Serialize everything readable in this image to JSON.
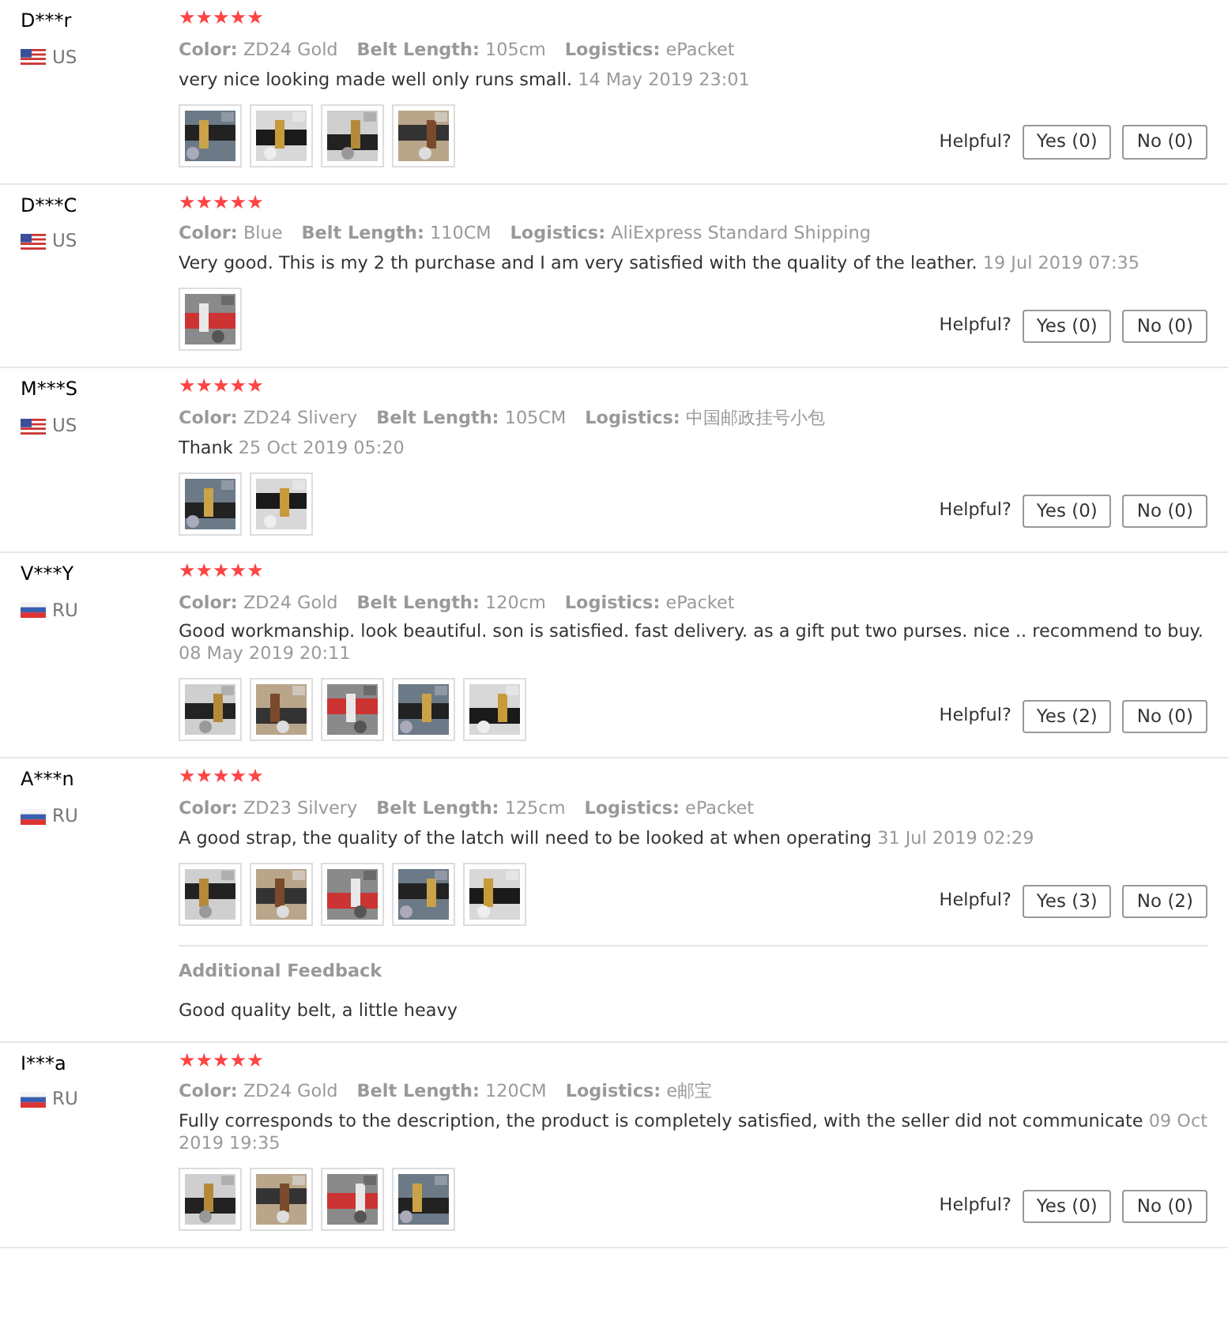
{
  "reviews": [
    {
      "name": "D***r",
      "country": {
        "code": "US",
        "kind": "us"
      },
      "stars": 5,
      "attributes": [
        {
          "label": "Color:",
          "value": "ZD24 Gold"
        },
        {
          "label": "Belt Length:",
          "value": "105cm"
        },
        {
          "label": "Logistics:",
          "value": "ePacket"
        }
      ],
      "text": "very nice looking made well only runs small.",
      "date": "14 May 2019 23:01",
      "photos": [
        {
          "kind": "picture"
        },
        {
          "kind": "picture"
        },
        {
          "kind": "picture"
        },
        {
          "kind": "picture"
        }
      ],
      "helpful_label": "Helpful?",
      "yes": "Yes (0)",
      "no": "No (0)"
    },
    {
      "name": "D***C",
      "country": {
        "code": "US",
        "kind": "us"
      },
      "stars": 5,
      "attributes": [
        {
          "label": "Color:",
          "value": "Blue"
        },
        {
          "label": "Belt Length:",
          "value": "110CM"
        },
        {
          "label": "Logistics:",
          "value": "AliExpress Standard Shipping"
        }
      ],
      "text": "Very good. This is my 2 th purchase and I am very satisfied with the quality of the leather.",
      "date": "19 Jul 2019 07:35",
      "photos": [
        {
          "kind": "picture"
        }
      ],
      "helpful_label": "Helpful?",
      "yes": "Yes (0)",
      "no": "No (0)"
    },
    {
      "name": "M***S",
      "country": {
        "code": "US",
        "kind": "us"
      },
      "stars": 5,
      "attributes": [
        {
          "label": "Color:",
          "value": "ZD24 Slivery"
        },
        {
          "label": "Belt Length:",
          "value": "105CM"
        },
        {
          "label": "Logistics:",
          "value": "中国邮政挂号小包"
        }
      ],
      "text": "Thank",
      "date": "25 Oct 2019 05:20",
      "photos": [
        {
          "kind": "picture"
        },
        {
          "kind": "picture"
        }
      ],
      "helpful_label": "Helpful?",
      "yes": "Yes (0)",
      "no": "No (0)"
    },
    {
      "name": "V***Y",
      "country": {
        "code": "RU",
        "kind": "ru"
      },
      "stars": 5,
      "attributes": [
        {
          "label": "Color:",
          "value": "ZD24 Gold"
        },
        {
          "label": "Belt Length:",
          "value": "120cm"
        },
        {
          "label": "Logistics:",
          "value": "ePacket"
        }
      ],
      "text": "Good workmanship. look beautiful. son is satisfied. fast delivery. as a gift put two purses. nice .. recommend to buy.",
      "date": "08 May 2019 20:11",
      "photos": [
        {
          "kind": "picture"
        },
        {
          "kind": "picture"
        },
        {
          "kind": "picture"
        },
        {
          "kind": "picture"
        },
        {
          "kind": "picture"
        }
      ],
      "helpful_label": "Helpful?",
      "yes": "Yes (2)",
      "no": "No (0)"
    },
    {
      "name": "A***n",
      "country": {
        "code": "RU",
        "kind": "ru"
      },
      "stars": 5,
      "attributes": [
        {
          "label": "Color:",
          "value": "ZD23 Silvery"
        },
        {
          "label": "Belt Length:",
          "value": "125cm"
        },
        {
          "label": "Logistics:",
          "value": "ePacket"
        }
      ],
      "text": "A good strap, the quality of the latch will need to be looked at when operating",
      "date": "31 Jul 2019 02:29",
      "photos": [
        {
          "kind": "picture"
        },
        {
          "kind": "picture"
        },
        {
          "kind": "picture"
        },
        {
          "kind": "picture"
        },
        {
          "kind": "picture"
        }
      ],
      "helpful_label": "Helpful?",
      "yes": "Yes (3)",
      "no": "No (2)",
      "additional": {
        "title": "Additional Feedback",
        "text": "Good quality belt, a little heavy"
      }
    },
    {
      "name": "I***a",
      "country": {
        "code": "RU",
        "kind": "ru"
      },
      "stars": 5,
      "attributes": [
        {
          "label": "Color:",
          "value": "ZD24 Gold"
        },
        {
          "label": "Belt Length:",
          "value": "120CM"
        },
        {
          "label": "Logistics:",
          "value": "e邮宝"
        }
      ],
      "text": "Fully corresponds to the description, the product is completely satisfied, with the seller did not communicate",
      "date": "09 Oct 2019 19:35",
      "photos": [
        {
          "kind": "picture"
        },
        {
          "kind": "picture"
        },
        {
          "kind": "picture"
        },
        {
          "kind": "picture"
        }
      ],
      "helpful_label": "Helpful?",
      "yes": "Yes (0)",
      "no": "No (0)"
    }
  ]
}
